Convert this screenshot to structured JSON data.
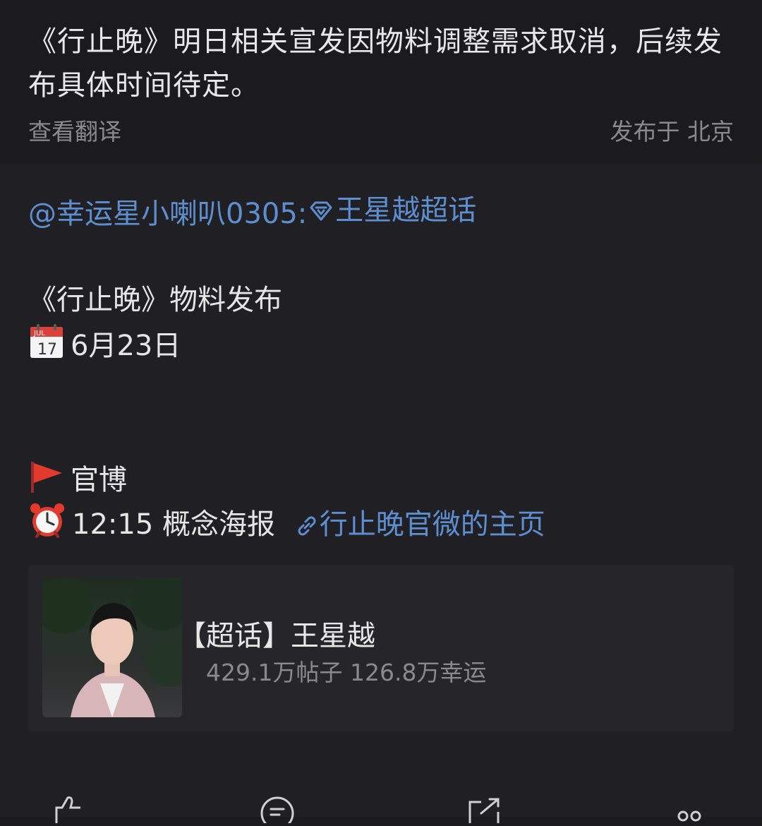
{
  "post": {
    "text": "《行止晚》明日相关宣发因物料调整需求取消，后续发布具体时间待定。",
    "translate_label": "查看翻译",
    "location_label": "发布于 北京"
  },
  "repost": {
    "mention": "@幸运星小喇叭0305",
    "colon": ":",
    "topic": "王星越超话",
    "title_line": "《行止晚》物料发布",
    "date_line": "6月23日",
    "calendar_month": "JUL",
    "calendar_day": "17",
    "official_label": "官博",
    "time_line": "12:15 概念海报",
    "link_label": "行止晚官微的主页"
  },
  "topic_card": {
    "title": "【超话】王星越",
    "stats": "429.1万帖子 126.8万幸运"
  },
  "colors": {
    "link": "#5d8fd0",
    "background": "#1b1b1e",
    "repost_background": "#202024"
  }
}
